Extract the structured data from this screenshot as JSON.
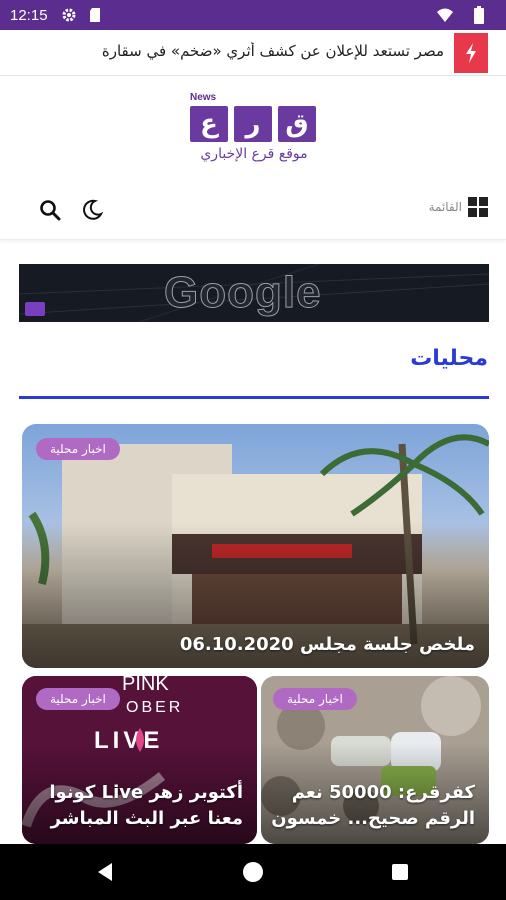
{
  "status_bar": {
    "time": "12:15",
    "icons_left": [
      "settings-icon",
      "sd-card-icon"
    ],
    "icons_right": [
      "wifi-icon",
      "battery-icon"
    ]
  },
  "ticker": {
    "icon": "flash-icon",
    "headline": "مصر تستعد للإعلان عن كشف أثري «ضخم» في سقارة"
  },
  "logo": {
    "news_label": "News",
    "letters": [
      "ق",
      "ر",
      "ع"
    ],
    "subtitle": "موقع قرع الإخباري"
  },
  "toolbar": {
    "menu_label": "القائمة",
    "icons": [
      "search-icon",
      "moon-icon",
      "grid-menu-icon"
    ]
  },
  "ad_banner": {
    "brand": "Google"
  },
  "section": {
    "title": "محليات"
  },
  "cards": [
    {
      "tag": "اخبار محلية",
      "title": "ملخص جلسة مجلس 06.10.2020"
    },
    {
      "tag": "اخبار محلية",
      "title": "أكتوبر زهر Live كونوا معنا عبر البث المباشر",
      "image_text": [
        "PINK",
        "OBER",
        "LIVE"
      ]
    },
    {
      "tag": "اخبار محلية",
      "title": "كفرقرع: 50000 نعم الرقم صحيح... خمسون"
    }
  ],
  "colors": {
    "status_bar": "#5b2d8e",
    "flash": "#e8394a",
    "accent_blue": "#2a3ad6",
    "tag": "#b06ac4",
    "logo_purple": "#6b3aa0"
  },
  "nav": [
    "back-button",
    "home-button",
    "recents-button"
  ]
}
